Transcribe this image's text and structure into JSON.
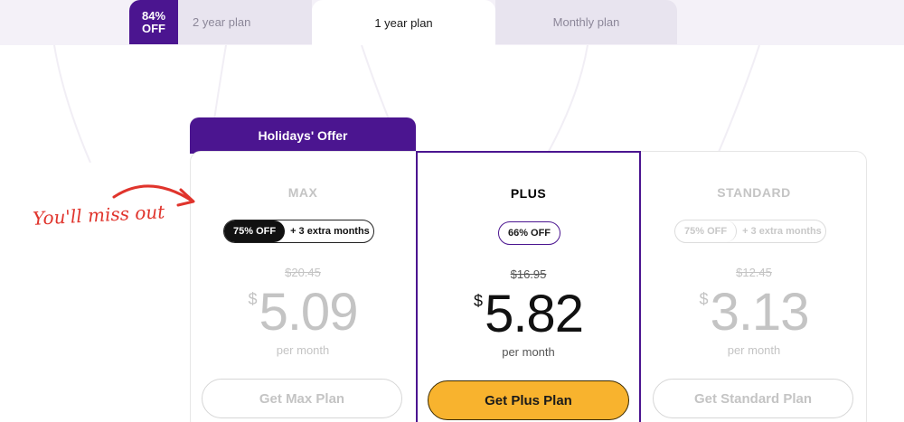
{
  "tabs": {
    "discount_top": "84%",
    "discount_bottom": "OFF",
    "two_year": "2 year plan",
    "one_year": "1 year plan",
    "monthly": "Monthly plan"
  },
  "promo": {
    "holiday_offer": "Holidays' Offer",
    "miss_out": "You'll miss out"
  },
  "plans": {
    "max": {
      "name": "MAX",
      "discount": "75% OFF",
      "extra": "+ 3 extra months",
      "old_price": "$20.45",
      "currency": "$",
      "price": "5.09",
      "period": "per month",
      "cta": "Get Max Plan"
    },
    "plus": {
      "name": "PLUS",
      "discount": "66% OFF",
      "old_price": "$16.95",
      "currency": "$",
      "price": "5.82",
      "period": "per month",
      "cta": "Get Plus Plan"
    },
    "standard": {
      "name": "STANDARD",
      "discount": "75% OFF",
      "extra": "+ 3 extra months",
      "old_price": "$12.45",
      "currency": "$",
      "price": "3.13",
      "period": "per month",
      "cta": "Get Standard Plan"
    }
  },
  "colors": {
    "brand_purple": "#4b1590",
    "cta_yellow": "#f8b32e",
    "note_red": "#e0342c"
  }
}
